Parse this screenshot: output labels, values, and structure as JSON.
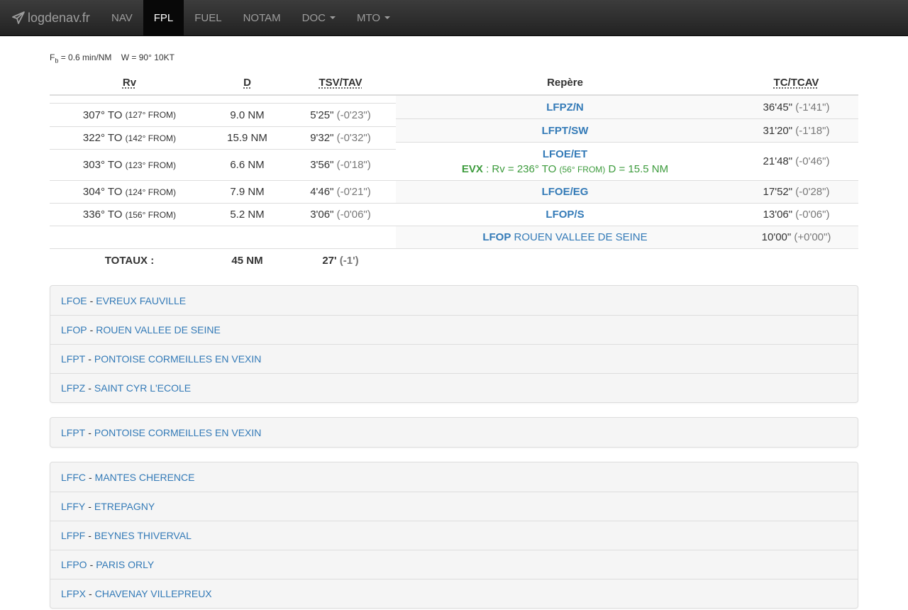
{
  "navbar": {
    "brand": "logdenav.fr",
    "items": [
      {
        "label": "NAV",
        "active": false,
        "dropdown": false
      },
      {
        "label": "FPL",
        "active": true,
        "dropdown": false
      },
      {
        "label": "FUEL",
        "active": false,
        "dropdown": false
      },
      {
        "label": "NOTAM",
        "active": false,
        "dropdown": false
      },
      {
        "label": "DOC",
        "active": false,
        "dropdown": true
      },
      {
        "label": "MTO",
        "active": false,
        "dropdown": true
      }
    ]
  },
  "params": {
    "fb_label": "F",
    "fb_sub": "b",
    "fb_value": " = 0.6 min/NM",
    "wind": "W = 90° 10KT"
  },
  "legs_table": {
    "headers": {
      "rv": "Rv",
      "d": "D",
      "tsv": "TSV/TAV"
    },
    "rows": [
      {
        "rv": "307° TO",
        "rv_from": "(127° FROM)",
        "d": "9.0 NM",
        "tsv": "5'25\"",
        "tav": "(-0'23\")"
      },
      {
        "rv": "322° TO",
        "rv_from": "(142° FROM)",
        "d": "15.9 NM",
        "tsv": "9'32\"",
        "tav": "(-0'32\")"
      },
      {
        "rv": "303° TO",
        "rv_from": "(123° FROM)",
        "d": "6.6 NM",
        "tsv": "3'56\"",
        "tav": "(-0'18\")"
      },
      {
        "rv": "304° TO",
        "rv_from": "(124° FROM)",
        "d": "7.9 NM",
        "tsv": "4'46\"",
        "tav": "(-0'21\")"
      },
      {
        "rv": "336° TO",
        "rv_from": "(156° FROM)",
        "d": "5.2 NM",
        "tsv": "3'06\"",
        "tav": "(-0'06\")"
      }
    ],
    "totals": {
      "label": "TOTAUX :",
      "d": "45 NM",
      "tsv": "27'",
      "tav": "(-1')"
    }
  },
  "waypoints_table": {
    "headers": {
      "repere": "Repère",
      "tc": "TC/TCAV"
    },
    "rows": [
      {
        "code": "LFPZ/N",
        "name": "",
        "tc": "36'45\"",
        "tcav": "(-1'41\")"
      },
      {
        "code": "LFPT/SW",
        "name": "",
        "tc": "31'20\"",
        "tcav": "(-1'18\")"
      },
      {
        "code": "LFOE/ET",
        "name": "",
        "tc": "21'48\"",
        "tcav": "(-0'46\")",
        "vor": {
          "id": "EVX",
          "text1": " : Rv = 236° TO ",
          "from": "(56° FROM)",
          "text2": " D = 15.5 NM"
        }
      },
      {
        "code": "LFOE/EG",
        "name": "",
        "tc": "17'52\"",
        "tcav": "(-0'28\")"
      },
      {
        "code": "LFOP/S",
        "name": "",
        "tc": "13'06\"",
        "tcav": "(-0'06\")"
      },
      {
        "code": "LFOP",
        "name": "ROUEN VALLEE DE SEINE",
        "tc": "10'00\"",
        "tcav": "(+0'00\")"
      }
    ]
  },
  "airport_groups": [
    [
      {
        "code": "LFOE",
        "name": "EVREUX FAUVILLE"
      },
      {
        "code": "LFOP",
        "name": "ROUEN VALLEE DE SEINE"
      },
      {
        "code": "LFPT",
        "name": "PONTOISE CORMEILLES EN VEXIN"
      },
      {
        "code": "LFPZ",
        "name": "SAINT CYR L'ECOLE"
      }
    ],
    [
      {
        "code": "LFPT",
        "name": "PONTOISE CORMEILLES EN VEXIN"
      }
    ],
    [
      {
        "code": "LFFC",
        "name": "MANTES CHERENCE"
      },
      {
        "code": "LFFY",
        "name": "ETREPAGNY"
      },
      {
        "code": "LFPF",
        "name": "BEYNES THIVERVAL"
      },
      {
        "code": "LFPO",
        "name": "PARIS ORLY"
      },
      {
        "code": "LFPX",
        "name": "CHAVENAY VILLEPREUX"
      }
    ]
  ],
  "separator": "-",
  "colors": {
    "link": "#337ab7",
    "vor": "#3c9b3c",
    "navbar": "#222222"
  }
}
